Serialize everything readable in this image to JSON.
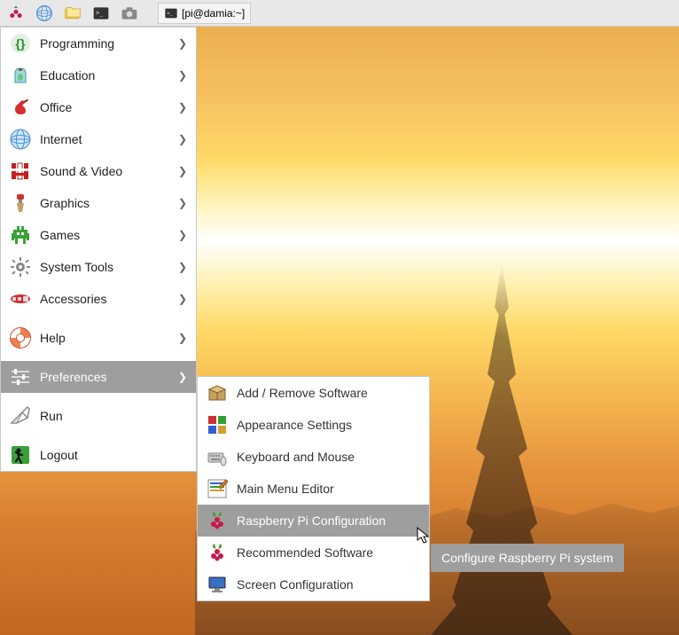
{
  "taskbar": {
    "window_title": "[pi@damia:~]"
  },
  "menu": [
    {
      "label": "Programming",
      "has_submenu": true
    },
    {
      "label": "Education",
      "has_submenu": true
    },
    {
      "label": "Office",
      "has_submenu": true
    },
    {
      "label": "Internet",
      "has_submenu": true
    },
    {
      "label": "Sound & Video",
      "has_submenu": true
    },
    {
      "label": "Graphics",
      "has_submenu": true
    },
    {
      "label": "Games",
      "has_submenu": true
    },
    {
      "label": "System Tools",
      "has_submenu": true
    },
    {
      "label": "Accessories",
      "has_submenu": true
    },
    {
      "label": "Help",
      "has_submenu": true
    },
    {
      "label": "Preferences",
      "has_submenu": true,
      "highlighted": true
    },
    {
      "label": "Run",
      "has_submenu": false
    },
    {
      "label": "Logout",
      "has_submenu": false
    }
  ],
  "submenu": [
    {
      "label": "Add / Remove Software"
    },
    {
      "label": "Appearance Settings"
    },
    {
      "label": "Keyboard and Mouse"
    },
    {
      "label": "Main Menu Editor"
    },
    {
      "label": "Raspberry Pi Configuration",
      "highlighted": true
    },
    {
      "label": "Recommended Software"
    },
    {
      "label": "Screen Configuration"
    }
  ],
  "tooltip": "Configure Raspberry Pi system"
}
